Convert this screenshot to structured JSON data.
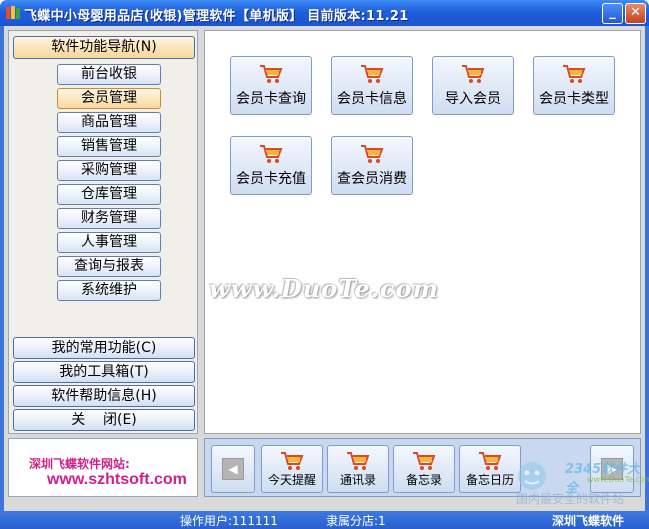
{
  "window": {
    "title": "飞蝶中小母婴用品店(收银)管理软件【单机版】 目前版本:11.21",
    "minimize_label": "_",
    "close_label": "✕"
  },
  "nav": {
    "header": "软件功能导航(N)",
    "items": [
      {
        "label": "前台收银"
      },
      {
        "label": "会员管理"
      },
      {
        "label": "商品管理"
      },
      {
        "label": "销售管理"
      },
      {
        "label": "采购管理"
      },
      {
        "label": "仓库管理"
      },
      {
        "label": "财务管理"
      },
      {
        "label": "人事管理"
      },
      {
        "label": "查询与报表"
      },
      {
        "label": "系统维护"
      }
    ],
    "active_index": 1,
    "bottom_buttons": [
      {
        "label": "我的常用功能(C)"
      },
      {
        "label": "我的工具箱(T)"
      },
      {
        "label": "软件帮助信息(H)"
      },
      {
        "label": "关    闭(E)"
      }
    ]
  },
  "main": {
    "functions": [
      {
        "label": "会员卡查询",
        "icon": "cart-icon"
      },
      {
        "label": "会员卡信息",
        "icon": "cart-icon"
      },
      {
        "label": "导入会员",
        "icon": "cart-icon"
      },
      {
        "label": "会员卡类型",
        "icon": "cart-icon"
      },
      {
        "label": "会员卡充值",
        "icon": "cart-icon"
      },
      {
        "label": "查会员消费",
        "icon": "cart-icon"
      }
    ],
    "watermark": "www.DuoTe.com"
  },
  "site": {
    "label": "深圳飞蝶软件网站:",
    "url": "www.szhtsoft.com"
  },
  "toolbar": {
    "buttons": [
      {
        "label": "今天提醒"
      },
      {
        "label": "通讯录"
      },
      {
        "label": "备忘录"
      },
      {
        "label": "备忘日历"
      }
    ]
  },
  "logo_watermark": {
    "brand": "2345软件大全",
    "site": "www.DuoTe.com",
    "slogan": "国内最安全的软件站"
  },
  "status": {
    "operator": "操作用户:111111",
    "store": "隶属分店:1",
    "company": "深圳飞蝶软件"
  },
  "colors": {
    "titlebar": "#1f5fdc",
    "status_text": "#ffffff",
    "site_text": "#d0208a",
    "active_nav": "#f8d9a0"
  }
}
